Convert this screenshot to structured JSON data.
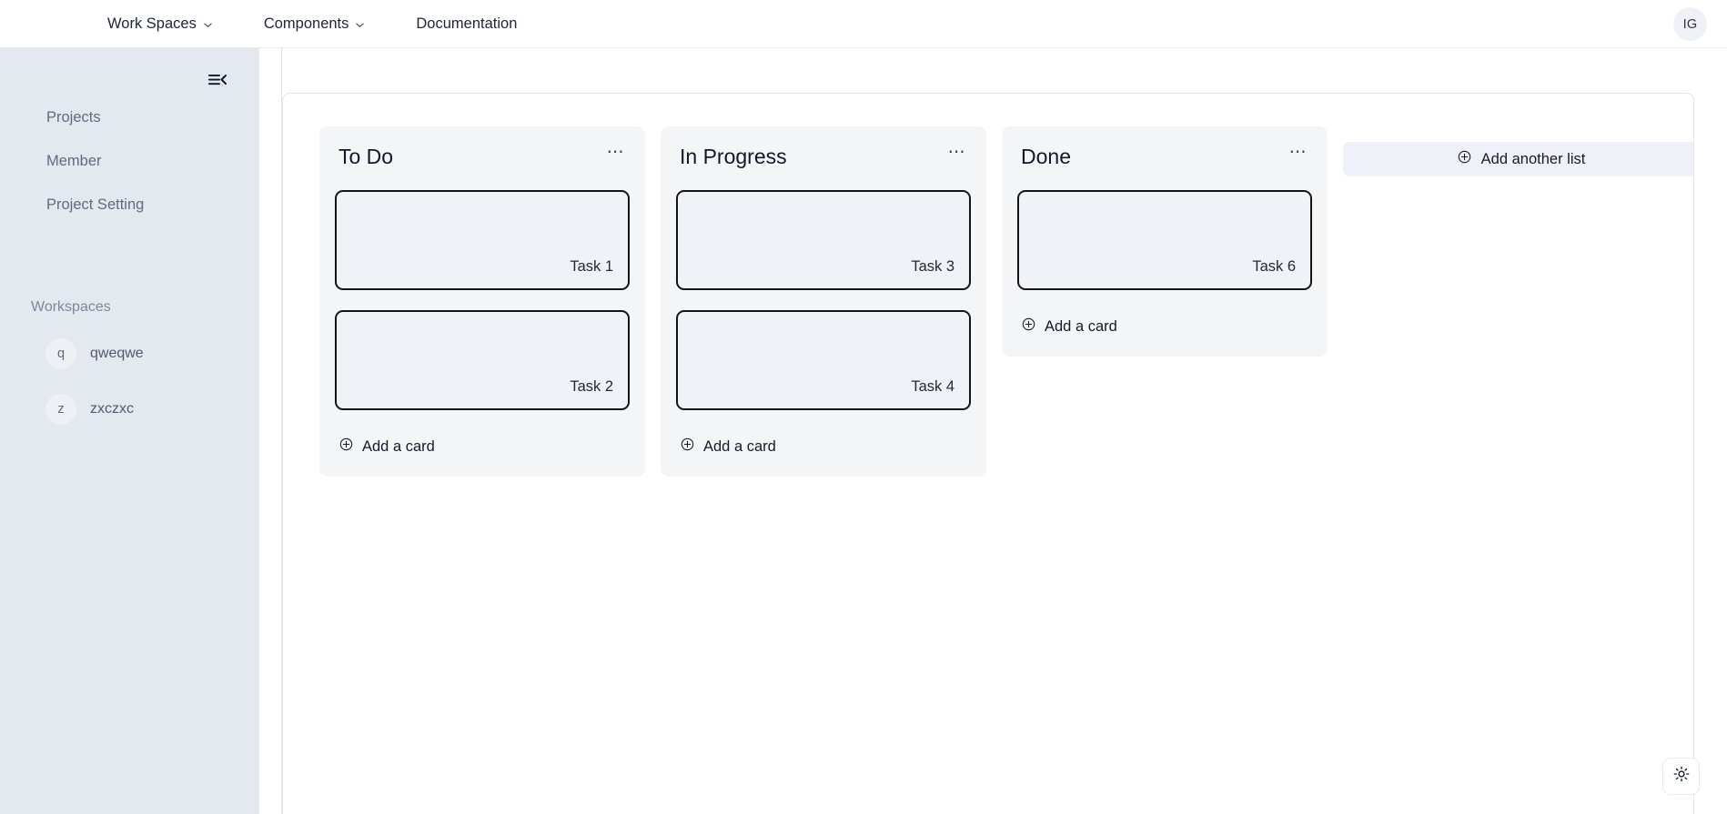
{
  "navbar": {
    "items": [
      {
        "label": "Work Spaces",
        "has_chevron": true,
        "icon": "chevron-down-icon"
      },
      {
        "label": "Components",
        "has_chevron": true,
        "icon": "chevron-down-icon"
      },
      {
        "label": "Documentation",
        "has_chevron": false,
        "icon": ""
      }
    ],
    "avatar_initials": "IG"
  },
  "sidebar": {
    "collapse_icon": "collapse-sidebar-icon",
    "links": [
      {
        "label": "Projects"
      },
      {
        "label": "Member"
      },
      {
        "label": "Project Setting"
      }
    ],
    "workspaces_heading": "Workspaces",
    "workspaces": [
      {
        "initial": "q",
        "name": "qweqwe"
      },
      {
        "initial": "z",
        "name": "zxczxc"
      }
    ]
  },
  "board": {
    "menu_icon": "ellipsis-icon",
    "add_card_icon": "plus-circle-icon",
    "add_list_icon": "plus-circle-icon",
    "add_card_label": "Add a card",
    "add_list_label": "Add another list",
    "lists": [
      {
        "title": "To Do",
        "cards": [
          {
            "label": "Task 1"
          },
          {
            "label": "Task 2"
          }
        ]
      },
      {
        "title": "In Progress",
        "cards": [
          {
            "label": "Task 3"
          },
          {
            "label": "Task 4"
          }
        ]
      },
      {
        "title": "Done",
        "cards": [
          {
            "label": "Task 6"
          }
        ]
      }
    ]
  },
  "theme_toggle": {
    "icon": "sun-icon"
  },
  "colors": {
    "sidebar_bg": "#e4e9f0",
    "list_bg": "#f4f5f7",
    "card_bg": "#eff2f7",
    "card_border": "#141414",
    "add_list_bg": "#eef2f8",
    "text_primary": "#10182b",
    "text_muted": "#5e6b80"
  }
}
